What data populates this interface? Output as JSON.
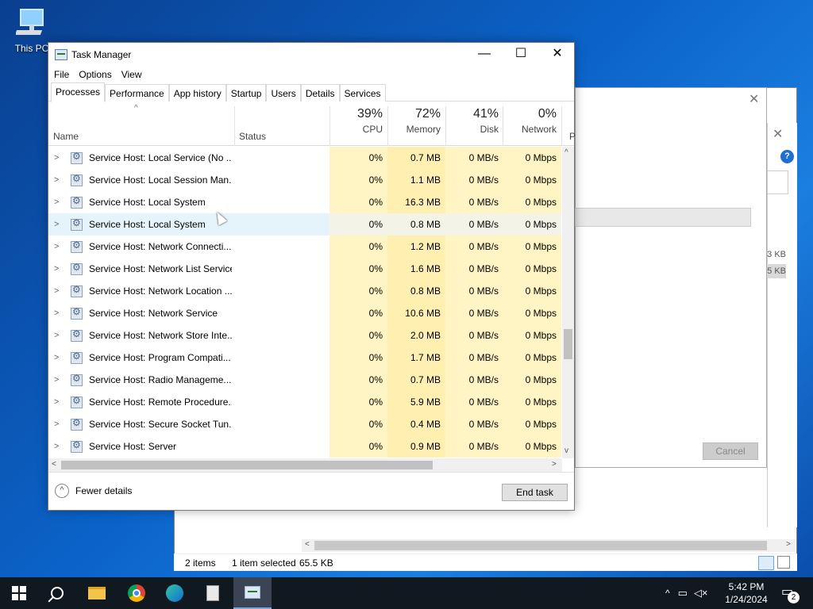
{
  "desktop": {
    "icon_label": "This PC"
  },
  "background_window": {
    "status_items": "2 items",
    "status_selected": "1 item selected",
    "status_size": "65.5 KB",
    "cancel_label": "Cancel",
    "kb_1": "3 KB",
    "kb_2": "5 KB"
  },
  "task_manager": {
    "title": "Task Manager",
    "menu": [
      "File",
      "Options",
      "View"
    ],
    "tabs": [
      "Processes",
      "Performance",
      "App history",
      "Startup",
      "Users",
      "Details",
      "Services"
    ],
    "active_tab": "Processes",
    "columns": {
      "name": "Name",
      "status": "Status",
      "cpu": {
        "pct": "39%",
        "label": "CPU"
      },
      "memory": {
        "pct": "72%",
        "label": "Memory"
      },
      "disk": {
        "pct": "41%",
        "label": "Disk"
      },
      "network": {
        "pct": "0%",
        "label": "Network"
      },
      "power_partial": "P"
    },
    "rows": [
      {
        "name": "Service Host: Local Service (No ...",
        "cpu": "0%",
        "memory": "0.7 MB",
        "disk": "0 MB/s",
        "network": "0 Mbps"
      },
      {
        "name": "Service Host: Local Session Man...",
        "cpu": "0%",
        "memory": "1.1 MB",
        "disk": "0 MB/s",
        "network": "0 Mbps"
      },
      {
        "name": "Service Host: Local System",
        "cpu": "0%",
        "memory": "16.3 MB",
        "disk": "0 MB/s",
        "network": "0 Mbps"
      },
      {
        "name": "Service Host: Local System",
        "cpu": "0%",
        "memory": "0.8 MB",
        "disk": "0 MB/s",
        "network": "0 Mbps"
      },
      {
        "name": "Service Host: Network Connecti...",
        "cpu": "0%",
        "memory": "1.2 MB",
        "disk": "0 MB/s",
        "network": "0 Mbps"
      },
      {
        "name": "Service Host: Network List Service",
        "cpu": "0%",
        "memory": "1.6 MB",
        "disk": "0 MB/s",
        "network": "0 Mbps"
      },
      {
        "name": "Service Host: Network Location ...",
        "cpu": "0%",
        "memory": "0.8 MB",
        "disk": "0 MB/s",
        "network": "0 Mbps"
      },
      {
        "name": "Service Host: Network Service",
        "cpu": "0%",
        "memory": "10.6 MB",
        "disk": "0 MB/s",
        "network": "0 Mbps"
      },
      {
        "name": "Service Host: Network Store Inte...",
        "cpu": "0%",
        "memory": "2.0 MB",
        "disk": "0 MB/s",
        "network": "0 Mbps"
      },
      {
        "name": "Service Host: Program Compati...",
        "cpu": "0%",
        "memory": "1.7 MB",
        "disk": "0 MB/s",
        "network": "0 Mbps"
      },
      {
        "name": "Service Host: Radio Manageme...",
        "cpu": "0%",
        "memory": "0.7 MB",
        "disk": "0 MB/s",
        "network": "0 Mbps"
      },
      {
        "name": "Service Host: Remote Procedure...",
        "cpu": "0%",
        "memory": "5.9 MB",
        "disk": "0 MB/s",
        "network": "0 Mbps"
      },
      {
        "name": "Service Host: Secure Socket Tun...",
        "cpu": "0%",
        "memory": "0.4 MB",
        "disk": "0 MB/s",
        "network": "0 Mbps"
      },
      {
        "name": "Service Host: Server",
        "cpu": "0%",
        "memory": "0.9 MB",
        "disk": "0 MB/s",
        "network": "0 Mbps"
      }
    ],
    "fewer_details": "Fewer details",
    "end_task": "End task"
  },
  "taskbar": {
    "time": "5:42 PM",
    "date": "1/24/2024",
    "notification_count": "2"
  },
  "icons": {
    "start": "windows-logo-icon",
    "search": "search-icon",
    "explorer": "folder-icon",
    "chrome": "chrome-icon",
    "edge": "edge-icon",
    "clipboard": "clipboard-icon",
    "task_manager": "task-manager-icon"
  },
  "colors": {
    "heat_light": "#fff4c4",
    "heat_memory": "#ffefb0",
    "row_hover": "#e5f3fb",
    "desktop_blue": "#0b63c9"
  }
}
